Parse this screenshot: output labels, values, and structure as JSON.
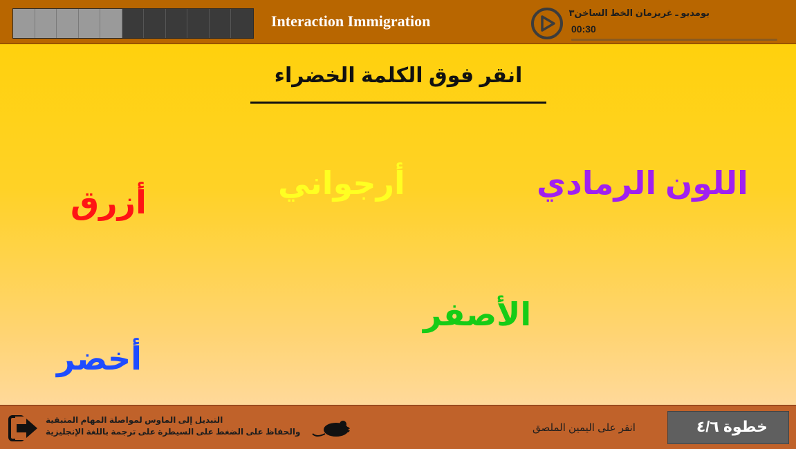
{
  "header": {
    "title": "Interaction Immigration",
    "progress": {
      "completed": 5,
      "total": 11
    },
    "player": {
      "track_name": "بومديو ـ غريزمان الخط الساخن٣",
      "time": "00:30",
      "play_icon": "play-circle-icon"
    }
  },
  "main": {
    "instruction": "انقر فوق الكلمة الخضراء",
    "words": [
      {
        "text": "أزرق",
        "color": "#ff1414"
      },
      {
        "text": "أرجواني",
        "color": "#ffff22"
      },
      {
        "text": "اللون الرمادي",
        "color": "#a020f0"
      },
      {
        "text": "الأصفر",
        "color": "#16cc16"
      },
      {
        "text": "أخضر",
        "color": "#1e4cff"
      }
    ]
  },
  "footer": {
    "exit_icon": "exit-arrow-icon",
    "mode_hint_line1": "التبديل إلى الماوس لمواصلة المهام المتبقية",
    "mode_hint_line2": "والحفاظ على الضغط على السيطرة على ترجمة باللغة الإنجليزية",
    "mouse_icon": "mouse-icon",
    "sticky_hint": "انقر على اليمين الملصق",
    "step_label": "خطوة ٤/٦"
  },
  "colors": {
    "header_bg": "#b86600",
    "footer_bg": "#c0622a",
    "main_gradient_top": "#ffd10d",
    "main_gradient_bottom": "#ffd99a",
    "step_box_bg": "#5f5f5f"
  }
}
